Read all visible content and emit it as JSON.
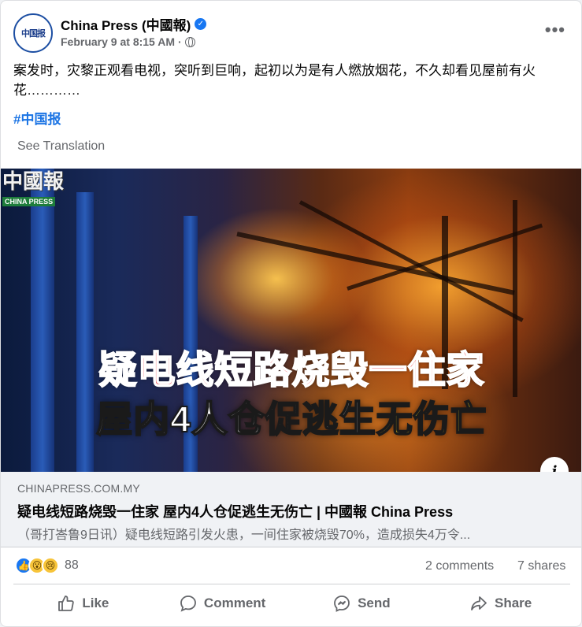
{
  "post": {
    "page_name": "China Press (中國報)",
    "avatar_text": "中国报",
    "timestamp": "February 9 at 8:15 AM",
    "separator": "·",
    "text": "案发时，灾黎正观看电视，突听到巨响，起初以为是有人燃放烟花，不久却看见屋前有火花…………",
    "hashtag": "#中国报",
    "see_translation": "See Translation",
    "more_label": "•••"
  },
  "image": {
    "logo_cn": "中國報",
    "logo_en": "CHINA PRESS",
    "headline_line1": "疑电线短路烧毁一住家",
    "headline_line2_white": "屋内4人仓促逃生",
    "headline_line2_yellow": "无伤亡",
    "info_label": "i"
  },
  "link_preview": {
    "domain": "CHINAPRESS.COM.MY",
    "title": "疑电线短路烧毁一住家 屋内4人仓促逃生无伤亡 | 中國報 China Press",
    "description": "（哥打峇鲁9日讯）疑电线短路引发火患，一间住家被烧毁70%，造成损失4万令..."
  },
  "stats": {
    "reaction_count": "88",
    "reactions": [
      "like-icon",
      "wow-icon",
      "sad-icon"
    ],
    "comments": "2 comments",
    "shares": "7 shares"
  },
  "actions": {
    "like": "Like",
    "comment": "Comment",
    "send": "Send",
    "share": "Share"
  },
  "colors": {
    "accent": "#1877f2",
    "hashtag": "#1b74e4",
    "secondary_text": "#65676b",
    "headline_red": "#e8262b",
    "headline_yellow": "#ffd81a"
  }
}
